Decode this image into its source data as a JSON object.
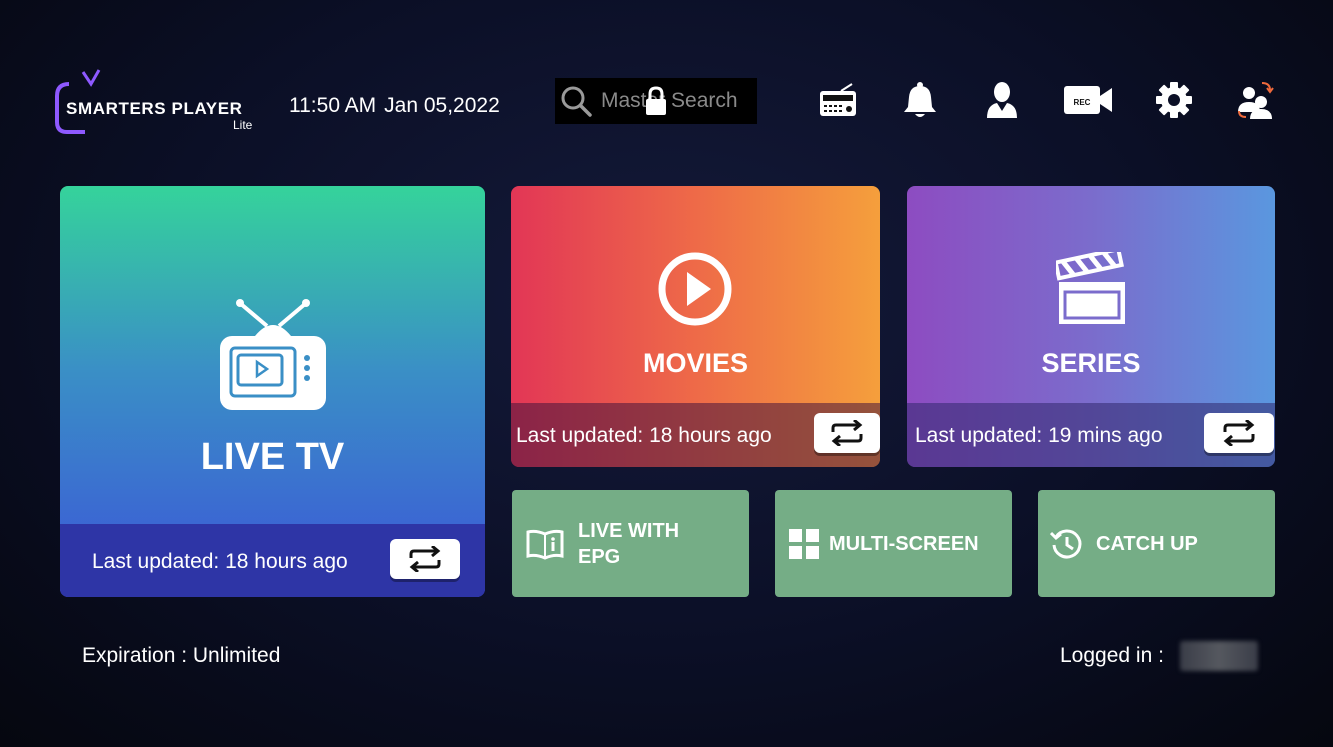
{
  "header": {
    "logo_title": "SMARTERS PLAYER",
    "logo_sub": "Lite",
    "time": "11:50 AM",
    "date": "Jan 05,2022",
    "search_placeholder": "Master Search"
  },
  "top_icons": [
    "radio-icon",
    "bell-icon",
    "user-icon",
    "rec-camera-icon",
    "gear-icon",
    "switch-user-icon"
  ],
  "rec_label": "REC",
  "tiles": {
    "live": {
      "label": "LIVE TV",
      "updated": "Last updated: 18 hours ago"
    },
    "movies": {
      "label": "MOVIES",
      "updated": "Last updated: 18 hours ago"
    },
    "series": {
      "label": "SERIES",
      "updated": "Last updated: 19 mins ago"
    }
  },
  "small_tiles": {
    "epg_line1": "LIVE WITH",
    "epg_line2": "EPG",
    "multi": "MULTI-SCREEN",
    "catchup": "CATCH UP"
  },
  "footer": {
    "expiration": "Expiration : Unlimited",
    "logged_in": "Logged in :"
  },
  "colors": {
    "small_tile": "#75ad86",
    "live_footer": "#2e35a6"
  }
}
